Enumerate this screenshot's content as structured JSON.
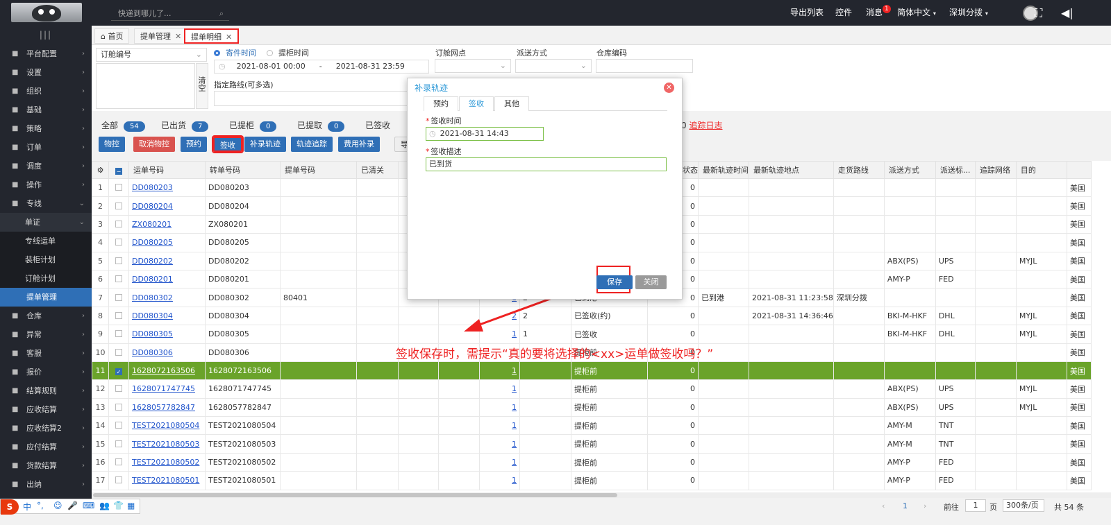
{
  "topbar": {
    "search_placeholder": "快递到哪儿了...",
    "export_list": "导出列表",
    "widgets": "控件",
    "messages": "消息",
    "messages_badge": "1",
    "language": "简体中文",
    "branch": "深圳分拨"
  },
  "sidebar": {
    "items": [
      {
        "label": "平台配置",
        "icon": "monitor-icon"
      },
      {
        "label": "设置",
        "icon": "gear-icon"
      },
      {
        "label": "组织",
        "icon": "org-icon"
      },
      {
        "label": "基础",
        "icon": "layers-icon"
      },
      {
        "label": "策略",
        "icon": "strategy-icon"
      },
      {
        "label": "订单",
        "icon": "list-icon"
      },
      {
        "label": "调度",
        "icon": "hand-icon"
      },
      {
        "label": "操作",
        "icon": "hand-icon"
      },
      {
        "label": "专线",
        "icon": "route-icon"
      }
    ],
    "sub_section": "单证",
    "sub_items": [
      "专线运单",
      "装柜计划",
      "订舱计划",
      "提单管理"
    ],
    "items_after": [
      {
        "label": "仓库",
        "icon": "warehouse-icon"
      },
      {
        "label": "异常",
        "icon": "alert-icon"
      },
      {
        "label": "客服",
        "icon": "service-icon"
      },
      {
        "label": "报价",
        "icon": "price-icon"
      },
      {
        "label": "结算规则",
        "icon": "rule-icon"
      },
      {
        "label": "应收结算",
        "icon": "receivable-icon"
      },
      {
        "label": "应收结算2",
        "icon": "receivable-icon"
      },
      {
        "label": "应付结算",
        "icon": "payable-icon"
      },
      {
        "label": "货款结算",
        "icon": "payment-icon"
      },
      {
        "label": "出纳",
        "icon": "cashier-icon"
      }
    ]
  },
  "tabs": [
    {
      "label": "首页"
    },
    {
      "label": "提单管理"
    },
    {
      "label": "提单明细"
    }
  ],
  "filter": {
    "order_no_select": "订舱编号",
    "clear": "清空",
    "time_send": "寄件时间",
    "time_pickup": "提柜时间",
    "date_from": "2021-08-01 00:00",
    "date_sep": "-",
    "date_to": "2021-08-31 23:59",
    "booking_point": "订舱网点",
    "delivery_method": "派送方式",
    "warehouse_code": "仓库编码",
    "route_label": "指定路线(可多选)"
  },
  "counts": [
    {
      "label": "全部",
      "value": "54"
    },
    {
      "label": "已出货",
      "value": "7"
    },
    {
      "label": "已提柜",
      "value": "0"
    },
    {
      "label": "已提取",
      "value": "0"
    },
    {
      "label": "已签收",
      "value": ""
    }
  ],
  "trail": {
    "prefix": "0",
    "link": "追踪日志"
  },
  "toolbar": [
    "物控",
    "取消物控",
    "预约",
    "签收",
    "补录轨迹",
    "轨迹追踪",
    "费用补录",
    "导"
  ],
  "grid": {
    "headers": [
      "",
      "",
      "运单号码",
      "转单号码",
      "提单号码",
      "已清关",
      "",
      "",
      "",
      "",
      "天数",
      "最新轨迹状态",
      "最新轨迹时间",
      "最新轨迹地点",
      "走货路线",
      "派送方式",
      "派送标...",
      "追踪网络",
      "目的"
    ],
    "rows": [
      {
        "n": "1",
        "no": "DD080203",
        "tr": "DD080203",
        "bl": "",
        "q": "",
        "st": "",
        "time": "",
        "loc": "",
        "route": "",
        "dm": "",
        "std": "",
        "net": "",
        "dest": "美国"
      },
      {
        "n": "2",
        "no": "DD080204",
        "tr": "DD080204",
        "bl": "",
        "q": "",
        "st": "",
        "time": "",
        "loc": "",
        "route": "",
        "dm": "",
        "std": "",
        "net": "",
        "dest": "美国"
      },
      {
        "n": "3",
        "no": "ZX080201",
        "tr": "ZX080201",
        "bl": "",
        "q": "",
        "st": "",
        "time": "",
        "loc": "",
        "route": "",
        "dm": "",
        "std": "",
        "net": "",
        "dest": "美国"
      },
      {
        "n": "4",
        "no": "DD080205",
        "tr": "DD080205",
        "bl": "",
        "q": "",
        "st": "",
        "time": "",
        "loc": "",
        "route": "",
        "dm": "",
        "std": "",
        "net": "",
        "dest": "美国"
      },
      {
        "n": "5",
        "no": "DD080202",
        "tr": "DD080202",
        "bl": "",
        "q": "",
        "st": "",
        "time": "",
        "loc": "",
        "route": "ABX(PS)",
        "dm": "UPS",
        "std": "",
        "net": "MYJL",
        "dest": "美国"
      },
      {
        "n": "6",
        "no": "DD080201",
        "tr": "DD080201",
        "bl": "",
        "q": "",
        "st": "",
        "time": "",
        "loc": "",
        "route": "AMY-P",
        "dm": "FED",
        "std": "",
        "net": "",
        "dest": "美国"
      },
      {
        "n": "7",
        "no": "DD080302",
        "tr": "DD080302",
        "bl": "80401",
        "q": "1",
        "qq": "2",
        "mid": "已到港",
        "st": "已到港",
        "time": "2021-08-31 11:23:58",
        "loc": "深圳分拨",
        "route": "",
        "dm": "",
        "std": "",
        "net": "",
        "dest": "美国"
      },
      {
        "n": "8",
        "no": "DD080304",
        "tr": "DD080304",
        "bl": "",
        "q": "2",
        "qq": "2",
        "mid": "已签收(约)",
        "st": "",
        "time": "2021-08-31 14:36:46",
        "loc": "",
        "route": "BKI-M-HKF",
        "dm": "DHL",
        "std": "",
        "net": "MYJL",
        "dest": "美国"
      },
      {
        "n": "9",
        "no": "DD080305",
        "tr": "DD080305",
        "bl": "",
        "q": "1",
        "qq": "1",
        "mid": "已签收",
        "st": "",
        "time": "",
        "loc": "",
        "route": "BKI-M-HKF",
        "dm": "DHL",
        "std": "",
        "net": "MYJL",
        "dest": "美国"
      },
      {
        "n": "10",
        "no": "DD080306",
        "tr": "DD080306",
        "bl": "",
        "q": "",
        "qq": "",
        "mid": "提柜前",
        "st": "",
        "time": "",
        "loc": "",
        "route": "",
        "dm": "",
        "std": "",
        "net": "",
        "dest": "美国"
      },
      {
        "n": "11",
        "no": "1628072163506",
        "tr": "1628072163506",
        "bl": "",
        "q": "1",
        "qq": "",
        "mid": "提柜前",
        "st": "",
        "time": "",
        "loc": "",
        "route": "",
        "dm": "",
        "std": "",
        "net": "",
        "dest": "美国"
      },
      {
        "n": "12",
        "no": "1628071747745",
        "tr": "1628071747745",
        "bl": "",
        "q": "1",
        "qq": "",
        "mid": "提柜前",
        "st": "",
        "time": "",
        "loc": "",
        "route": "ABX(PS)",
        "dm": "UPS",
        "std": "",
        "net": "MYJL",
        "dest": "美国"
      },
      {
        "n": "13",
        "no": "1628057782847",
        "tr": "1628057782847",
        "bl": "",
        "q": "1",
        "qq": "",
        "mid": "提柜前",
        "st": "",
        "time": "",
        "loc": "",
        "route": "ABX(PS)",
        "dm": "UPS",
        "std": "",
        "net": "MYJL",
        "dest": "美国"
      },
      {
        "n": "14",
        "no": "TEST2021080504",
        "tr": "TEST2021080504",
        "bl": "",
        "q": "1",
        "qq": "",
        "mid": "提柜前",
        "st": "",
        "time": "",
        "loc": "",
        "route": "AMY-M",
        "dm": "TNT",
        "std": "",
        "net": "",
        "dest": "美国"
      },
      {
        "n": "15",
        "no": "TEST2021080503",
        "tr": "TEST2021080503",
        "bl": "",
        "q": "1",
        "qq": "",
        "mid": "提柜前",
        "st": "",
        "time": "",
        "loc": "",
        "route": "AMY-M",
        "dm": "TNT",
        "std": "",
        "net": "",
        "dest": "美国"
      },
      {
        "n": "16",
        "no": "TEST2021080502",
        "tr": "TEST2021080502",
        "bl": "",
        "q": "1",
        "qq": "",
        "mid": "提柜前",
        "st": "",
        "time": "",
        "loc": "",
        "route": "AMY-P",
        "dm": "FED",
        "std": "",
        "net": "",
        "dest": "美国"
      },
      {
        "n": "17",
        "no": "TEST2021080501",
        "tr": "TEST2021080501",
        "bl": "",
        "q": "1",
        "qq": "",
        "mid": "提柜前",
        "st": "",
        "time": "",
        "loc": "",
        "route": "AMY-P",
        "dm": "FED",
        "std": "",
        "net": "",
        "dest": "美国"
      }
    ],
    "days": "0"
  },
  "pager": {
    "page": "1",
    "goto_label": "前往",
    "goto_value": "1",
    "page_unit": "页",
    "page_size": "300条/页",
    "total": "共 54 条"
  },
  "dialog": {
    "title": "补录轨迹",
    "tabs": [
      "预约",
      "签收",
      "其他"
    ],
    "time_label": "签收时间",
    "time_value": "2021-08-31 14:43",
    "desc_label": "签收描述",
    "desc_value": "已到货",
    "save": "保存",
    "close": "关闭"
  },
  "annotation": "签收保存时，需提示“真的要将选择的<xx>运单做签收吗？”",
  "ime": {
    "brand": "S",
    "chars": [
      "中",
      "°,",
      "☺",
      "🎤",
      "⌨",
      "👥",
      "👕",
      "▦"
    ]
  },
  "colors": {
    "accent": "#2f6fb6",
    "highlight_row": "#6aa32a",
    "annotation": "#e22222"
  }
}
